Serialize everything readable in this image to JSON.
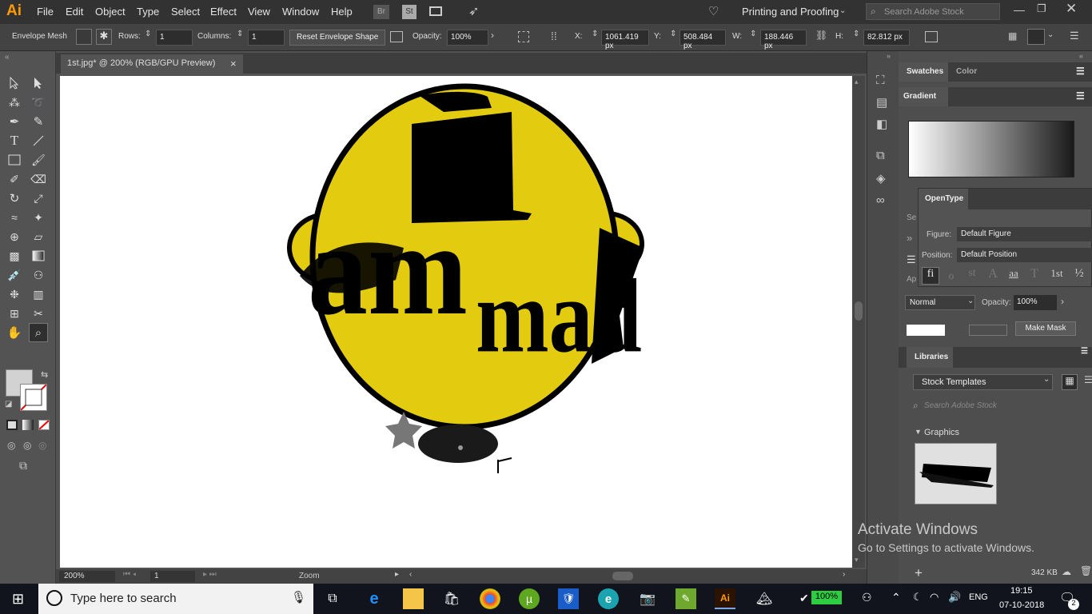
{
  "app": {
    "logo": "Ai"
  },
  "menu": [
    "File",
    "Edit",
    "Object",
    "Type",
    "Select",
    "Effect",
    "View",
    "Window",
    "Help"
  ],
  "bridge_icons": [
    "Br",
    "St"
  ],
  "workspace": "Printing and Proofing",
  "search_stock": "Search Adobe Stock",
  "control": {
    "mode_label": "Envelope Mesh",
    "rows_label": "Rows:",
    "rows": "1",
    "columns_label": "Columns:",
    "columns": "1",
    "reset_button": "Reset Envelope Shape",
    "opacity_label": "Opacity:",
    "opacity": "100%",
    "x_label": "X:",
    "x": "1061.419 px",
    "y_label": "Y:",
    "y": "508.484 px",
    "w_label": "W:",
    "w": "188.446 px",
    "h_label": "H:",
    "h": "82.812 px"
  },
  "document": {
    "tab_title": "1st.jpg* @ 200% (RGB/GPU Preview)",
    "close": "×"
  },
  "artwork": {
    "word_left": "am",
    "word_right": "mad"
  },
  "status": {
    "zoom": "200%",
    "artboard": "1",
    "tool": "Zoom"
  },
  "panels": {
    "swatches_tab": "Swatches",
    "color_tab": "Color",
    "gradient_tab": "Gradient",
    "se_label": "Se",
    "ap_label": "Ap",
    "opentype_tab": "OpenType",
    "figure_label": "Figure:",
    "figure_value": "Default Figure",
    "position_label": "Position:",
    "position_value": "Default Position",
    "ot_glyphs": [
      "fi",
      "ℴ",
      "st",
      "A",
      "aa",
      "T",
      "1st",
      "½"
    ],
    "blend_mode": "Normal",
    "transp_opacity_label": "Opacity:",
    "transp_opacity": "100%",
    "make_mask": "Make Mask",
    "libraries_tab": "Libraries",
    "library_select": "Stock Templates",
    "library_search": "Search Adobe Stock",
    "graphics_label": "Graphics",
    "lib_size": "342 KB"
  },
  "watermark": {
    "title": "Activate Windows",
    "sub": "Go to Settings to activate Windows."
  },
  "taskbar": {
    "search_placeholder": "Type here to search",
    "battery": "100%",
    "lang": "ENG",
    "time": "19:15",
    "date": "07-10-2018",
    "notif_count": "2"
  },
  "colors": {
    "accent": "#ff9a00",
    "yellow": "#e3cb10",
    "black": "#000000"
  }
}
